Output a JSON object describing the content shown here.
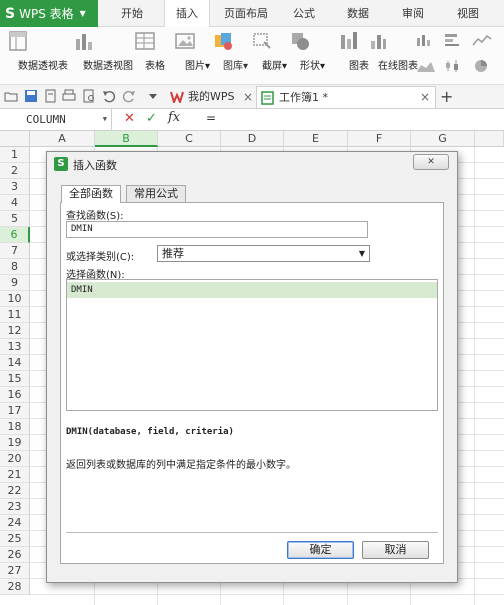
{
  "app": {
    "name": "WPS 表格",
    "logo": "S"
  },
  "menu_tabs": [
    "开始",
    "插入",
    "页面布局",
    "公式",
    "数据",
    "审阅",
    "视图"
  ],
  "active_menu_tab": "插入",
  "ribbon": {
    "items": [
      "数据透视表",
      "数据透视图",
      "表格",
      "图片",
      "图库",
      "截屏",
      "形状",
      "图表",
      "在线图表"
    ],
    "dropdown_marker": "▾"
  },
  "doc_tabs": [
    {
      "label": "我的WPS",
      "close": "×"
    },
    {
      "label": "工作簿1 *",
      "close": "×"
    }
  ],
  "new_tab_symbol": "+",
  "formula_bar": {
    "name_box": "COLUMN",
    "cancel": "✕",
    "confirm": "✓",
    "fx": "fx",
    "equals": "="
  },
  "columns": [
    "A",
    "B",
    "C",
    "D",
    "E",
    "F",
    "G"
  ],
  "selected_column": "B",
  "rows": [
    "1",
    "2",
    "3",
    "4",
    "5",
    "6",
    "7",
    "8",
    "9",
    "10",
    "11",
    "12",
    "13",
    "14",
    "15",
    "16",
    "17",
    "18",
    "19",
    "20",
    "21",
    "22",
    "23",
    "24",
    "25",
    "26",
    "27",
    "28"
  ],
  "selected_row": "6",
  "dialog": {
    "title": "插入函数",
    "close_label": "✕",
    "tabs": [
      "全部函数",
      "常用公式"
    ],
    "active_tab": "全部函数",
    "search_label": "查找函数(S):",
    "search_value": "DMIN",
    "category_label": "或选择类别(C):",
    "category_value": "推荐",
    "function_list_label": "选择函数(N):",
    "functions": [
      "DMIN"
    ],
    "selected_function": "DMIN",
    "syntax": "DMIN(database, field, criteria)",
    "description": "返回列表或数据库的列中满足指定条件的最小数字。",
    "ok_label": "确定",
    "cancel_label": "取消"
  },
  "colors": {
    "brand_green": "#2f9a43",
    "selection_green": "#dcefd9",
    "list_highlight": "#d7ead1",
    "focus_blue": "#3f78c6"
  }
}
